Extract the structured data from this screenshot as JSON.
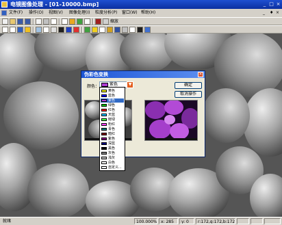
{
  "window": {
    "title": "电镜图像处理 - [01-10000.bmp]",
    "controls": [
      "_",
      "□",
      "×"
    ]
  },
  "menu": {
    "items": [
      "文件(F)",
      "操作(O)",
      "视图(V)",
      "图像处理(I)",
      "粒度分析(P)",
      "窗口(W)",
      "帮助(H)"
    ],
    "mdi_controls": [
      "_",
      "♦",
      "×"
    ]
  },
  "toolbar1": {
    "zoom_label": "缩放"
  },
  "dialog": {
    "title": "伪彩色变换",
    "color_label": "颜色：",
    "selected_color": "紫色",
    "ok_label": "确定",
    "cancel_label": "取消操作",
    "close_glyph": "×",
    "dropdown_arrow": "▼"
  },
  "color_options": [
    {
      "label": "黄色",
      "color": "#ffff00"
    },
    {
      "label": "蓝色",
      "color": "#0000ff"
    },
    {
      "label": "紫色",
      "color": "#ad3ad2"
    },
    {
      "label": "绿色",
      "color": "#00c000"
    },
    {
      "label": "红色",
      "color": "#ff0000"
    },
    {
      "label": "天蓝",
      "color": "#00c0ff"
    },
    {
      "label": "鲜绿",
      "color": "#40ff40"
    },
    {
      "label": "粉红",
      "color": "#ff40ff"
    },
    {
      "label": "青色",
      "color": "#008080"
    },
    {
      "label": "暗红",
      "color": "#800000"
    },
    {
      "label": "紫色",
      "color": "#800080"
    },
    {
      "label": "深蓝",
      "color": "#000080"
    },
    {
      "label": "黑色",
      "color": "#000000"
    },
    {
      "label": "灰色",
      "color": "#808080"
    },
    {
      "label": "浅灰",
      "color": "#c0c0c0"
    },
    {
      "label": "白色",
      "color": "#ffffff"
    },
    {
      "label": "自定义...",
      "color": "#ffffff"
    }
  ],
  "selected_index": 2,
  "status": {
    "ready": "就绪",
    "zoom": "100.000%",
    "x": "x: 285",
    "y": "y: 0",
    "rgb": "r:172,g:172,b:172"
  }
}
